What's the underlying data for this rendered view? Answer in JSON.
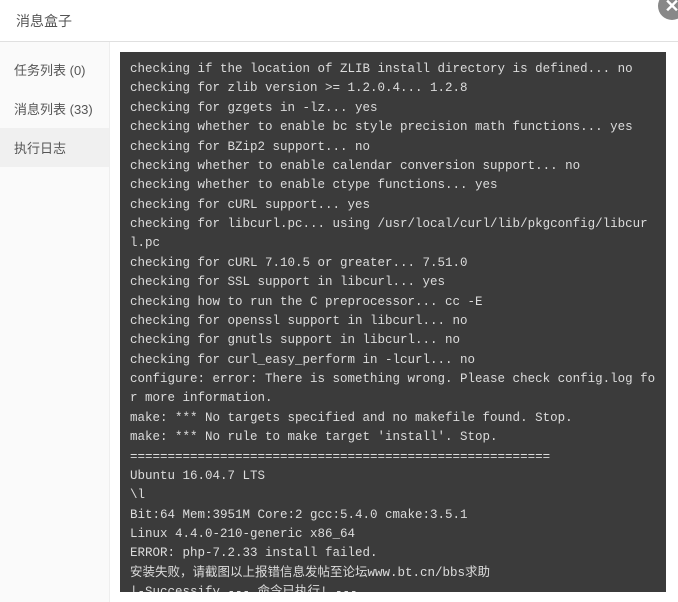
{
  "header": {
    "title": "消息盒子"
  },
  "close_label": "✕",
  "sidebar": {
    "items": [
      {
        "label": "任务列表 (0)"
      },
      {
        "label": "消息列表 (33)"
      },
      {
        "label": "执行日志"
      }
    ]
  },
  "terminal": {
    "lines": [
      "checking if the location of ZLIB install directory is defined... no",
      "checking for zlib version >= 1.2.0.4... 1.2.8",
      "checking for gzgets in -lz... yes",
      "checking whether to enable bc style precision math functions... yes",
      "checking for BZip2 support... no",
      "checking whether to enable calendar conversion support... no",
      "checking whether to enable ctype functions... yes",
      "checking for cURL support... yes",
      "checking for libcurl.pc... using /usr/local/curl/lib/pkgconfig/libcurl.pc",
      "checking for cURL 7.10.5 or greater... 7.51.0",
      "checking for SSL support in libcurl... yes",
      "checking how to run the C preprocessor... cc -E",
      "checking for openssl support in libcurl... no",
      "checking for gnutls support in libcurl... no",
      "checking for curl_easy_perform in -lcurl... no",
      "configure: error: There is something wrong. Please check config.log for more information.",
      "make: *** No targets specified and no makefile found. Stop.",
      "make: *** No rule to make target 'install'. Stop.",
      "========================================================",
      "Ubuntu 16.04.7 LTS",
      "\\l",
      "",
      "Bit:64 Mem:3951M Core:2 gcc:5.4.0 cmake:3.5.1",
      "Linux 4.4.0-210-generic x86_64",
      "ERROR: php-7.2.33 install failed.",
      "安装失败，请截图以上报错信息发帖至论坛www.bt.cn/bbs求助",
      "|-Successify --- 命令已执行! ---"
    ]
  }
}
